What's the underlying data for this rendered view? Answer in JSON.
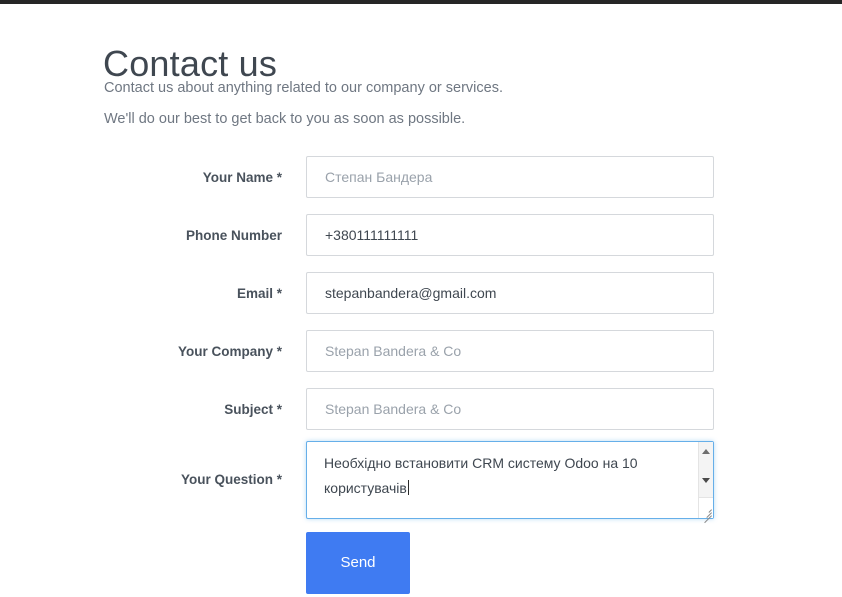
{
  "page": {
    "title": "Contact us",
    "subtitle_line1": "Contact us about anything related to our company or services.",
    "subtitle_line2": "We'll do our best to get back to you as soon as possible.",
    "accent_color": "#3f7bf2",
    "focus_border_color": "#66afe9",
    "label_color": "#49525c",
    "text_color": "#3f4750",
    "placeholder_color": "#9aa2ab"
  },
  "form": {
    "fields": [
      {
        "name": "your-name",
        "label": "Your Name *",
        "value": "Степан Бандера",
        "placeholder": "Степан Бандера",
        "is_placeholder": true,
        "type": "text"
      },
      {
        "name": "phone-number",
        "label": "Phone Number",
        "value": "+380111111111",
        "placeholder": "",
        "is_placeholder": false,
        "type": "text"
      },
      {
        "name": "email",
        "label": "Email *",
        "value": "stepanbandera@gmail.com",
        "placeholder": "",
        "is_placeholder": false,
        "type": "email"
      },
      {
        "name": "your-company",
        "label": "Your Company *",
        "value": "Stepan Bandera & Co",
        "placeholder": "Stepan Bandera & Co",
        "is_placeholder": true,
        "type": "text"
      },
      {
        "name": "subject",
        "label": "Subject *",
        "value": "Stepan Bandera & Co",
        "placeholder": "Stepan Bandera & Co",
        "is_placeholder": true,
        "type": "text"
      }
    ],
    "question": {
      "name": "your-question",
      "label": "Your Question *",
      "value": "Необхідно встановити CRM систему Odoo на 10 користувачів",
      "focused": true,
      "has_scrollbar": true,
      "has_resize_grip": true
    },
    "submit": {
      "label": "Send"
    }
  }
}
